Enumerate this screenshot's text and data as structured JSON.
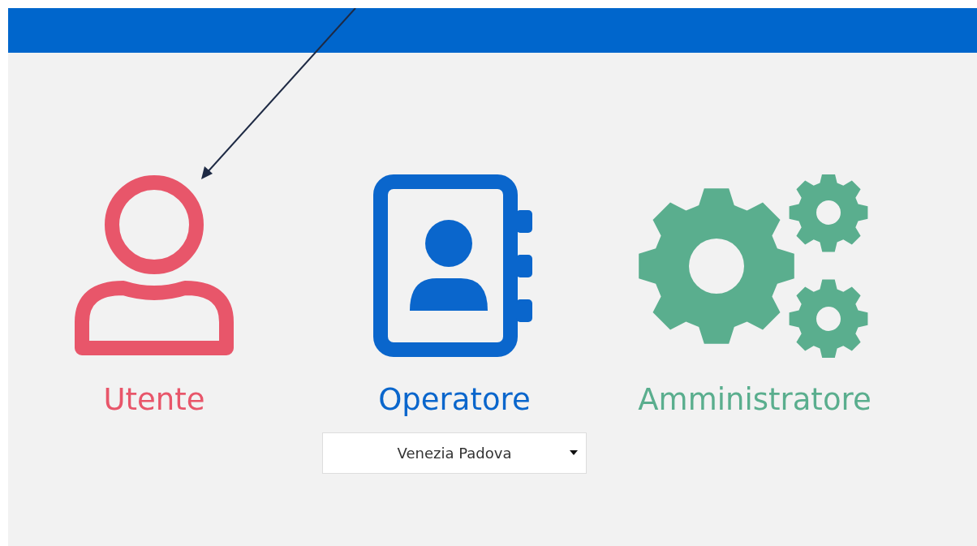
{
  "header": {
    "kind": "bar"
  },
  "roles": [
    {
      "kind": "user",
      "label": "Utente",
      "color": "#e8566a"
    },
    {
      "kind": "address-book",
      "label": "Operatore",
      "color": "#0a66cc",
      "dropdown": {
        "value": "Venezia Padova"
      }
    },
    {
      "kind": "gears",
      "label": "Amministratore",
      "color": "#5aae8e"
    }
  ]
}
